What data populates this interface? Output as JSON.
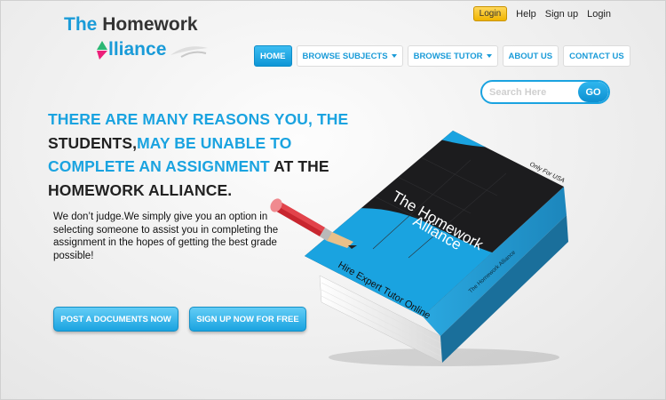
{
  "logo": {
    "line1_a": "The",
    "line1_b": "Homework",
    "line2": "lliance"
  },
  "toplinks": {
    "login_badge": "Login",
    "help": "Help",
    "signup": "Sign up",
    "login": "Login"
  },
  "nav": [
    {
      "label": "HOME",
      "active": true,
      "dropdown": false
    },
    {
      "label": "BROWSE SUBJECTS",
      "active": false,
      "dropdown": true
    },
    {
      "label": "BROWSE TUTOR",
      "active": false,
      "dropdown": true
    },
    {
      "label": "ABOUT US",
      "active": false,
      "dropdown": false
    },
    {
      "label": "CONTACT US",
      "active": false,
      "dropdown": false
    }
  ],
  "search": {
    "placeholder": "Search Here",
    "button": "GO"
  },
  "headline": {
    "p1": "THERE ARE MANY REASONS YOU, THE",
    "p2": "STUDENTS,",
    "p3": "MAY BE UNABLE TO",
    "p4": "COMPLETE AN ASSIGNMENT",
    "p5": " AT THE",
    "p6": "HOMEWORK ALLIANCE."
  },
  "body_text": "We don’t judge.We simply give you an option in selecting someone to assist you in completing the assignment in the hopes of getting the best grade possible!",
  "buttons": {
    "post": "POST A DOCUMENTS NOW",
    "signup": "SIGN UP NOW FOR FREE"
  },
  "book": {
    "only_for": "Only For USA",
    "title_1": "The Homework",
    "title_2": "Alliance",
    "tagline": "Hire Expert Tutor Online",
    "spine": "The Homework Alliance"
  },
  "colors": {
    "accent": "#1aa3e0",
    "dark": "#222222",
    "badge": "#f0b400",
    "book_black": "#1c1c1e"
  },
  "icons": {
    "logo_mark": "triangle-logo-icon",
    "pencil": "pencil-icon",
    "caret": "chevron-down-icon"
  }
}
